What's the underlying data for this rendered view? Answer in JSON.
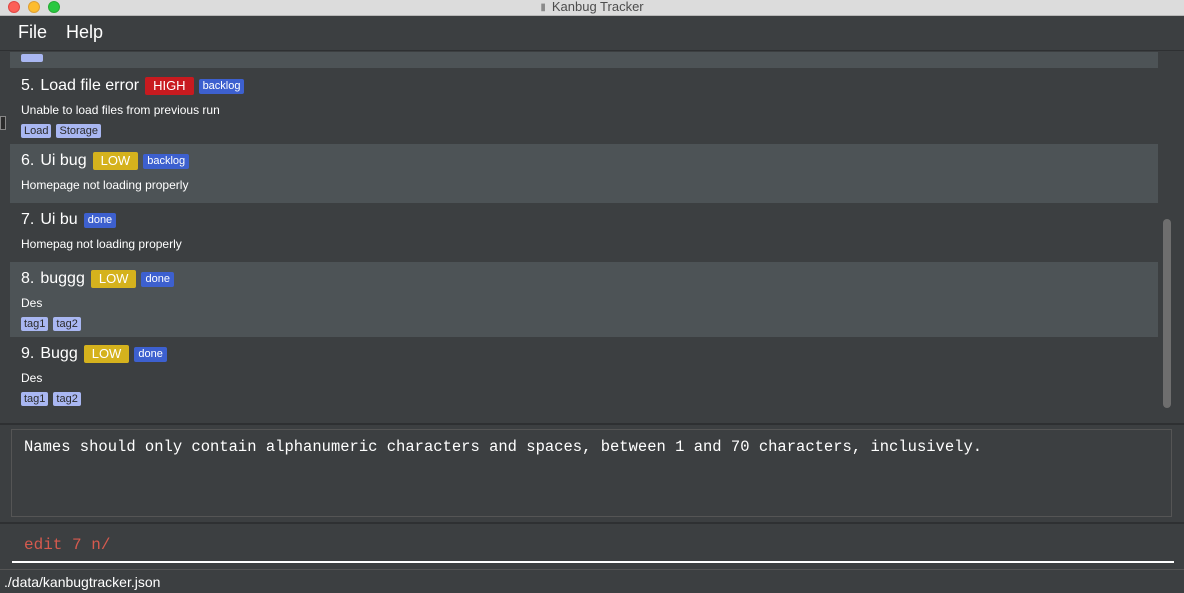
{
  "window": {
    "title": "Kanbug Tracker"
  },
  "menu": {
    "file": "File",
    "help": "Help"
  },
  "bugs": [
    {
      "index": "5.",
      "title": "Load file error",
      "priority": "HIGH",
      "state": "backlog",
      "description": "Unable to load files from previous run",
      "tags": [
        "Load",
        "Storage"
      ]
    },
    {
      "index": "6.",
      "title": "Ui bug",
      "priority": "LOW",
      "state": "backlog",
      "description": "Homepage not loading properly",
      "tags": []
    },
    {
      "index": "7.",
      "title": "Ui bu",
      "priority": "",
      "state": "done",
      "description": "Homepag not loading properly",
      "tags": []
    },
    {
      "index": "8.",
      "title": "buggg",
      "priority": "LOW",
      "state": "done",
      "description": "Des",
      "tags": [
        "tag1",
        "tag2"
      ]
    },
    {
      "index": "9.",
      "title": "Bugg",
      "priority": "LOW",
      "state": "done",
      "description": "Des",
      "tags": [
        "tag1",
        "tag2"
      ]
    }
  ],
  "result": {
    "message": "Names should only contain alphanumeric characters and spaces, between 1 and 70 characters, inclusively."
  },
  "command": {
    "value": "edit 7 n/"
  },
  "status": {
    "file_path": "./data/kanbugtracker.json"
  },
  "colors": {
    "high": "#c81a1f",
    "low": "#d5b21d",
    "state": "#3d60cf",
    "tag": "#a9b7f2",
    "command_text": "#d65a4e"
  }
}
